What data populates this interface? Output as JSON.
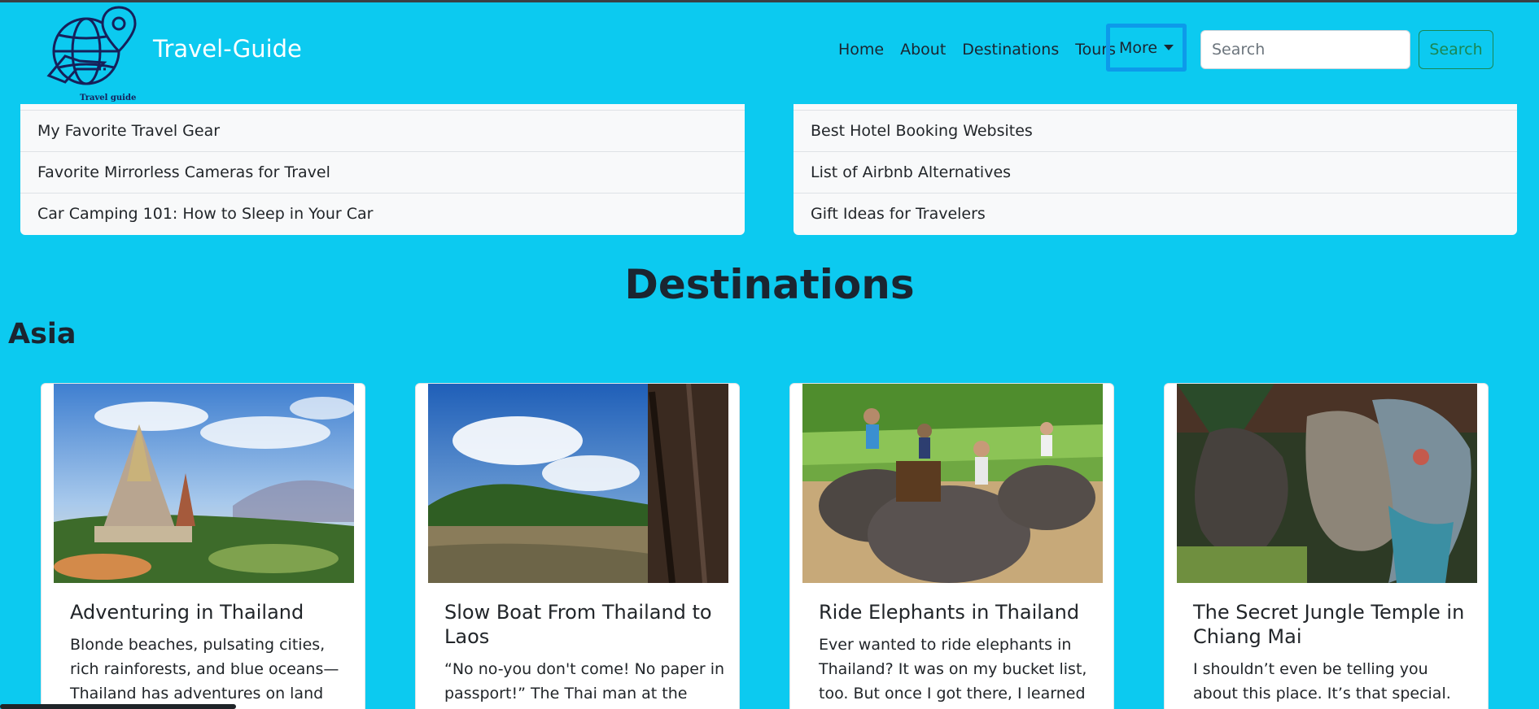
{
  "navbar": {
    "brand": "Travel-Guide",
    "logo_caption": "Travel guide",
    "links": [
      "Home",
      "About",
      "Destinations",
      "Tours"
    ],
    "more_label": "More",
    "search_placeholder": "Search",
    "search_button": "Search"
  },
  "dropdown": {
    "left_items": [
      "My Favorite Travel Gear",
      "Favorite Mirrorless Cameras for Travel",
      "Car Camping 101: How to Sleep in Your Car"
    ],
    "right_items": [
      "Best Hotel Booking Websites",
      "List of Airbnb Alternatives",
      "Gift Ideas for Travelers"
    ]
  },
  "main": {
    "section_title": "Destinations",
    "region_title": "Asia",
    "cards": [
      {
        "title": "Adventuring in Thailand",
        "text": "Blonde beaches, pulsating cities, rich rainforests, and blue oceans—Thailand has adventures on land and"
      },
      {
        "title": "Slow Boat From Thailand to Laos",
        "text": "“No no-you don't come! No paper in passport!” The Thai man at the"
      },
      {
        "title": "Ride Elephants in Thailand",
        "text": "Ever wanted to ride elephants in Thailand? It was on my bucket list, too. But once I got there, I learned—"
      },
      {
        "title": "The Secret Jungle Temple in Chiang Mai",
        "text": "I shouldn’t even be telling you about this place. It’s that special. Wat Palad"
      }
    ]
  },
  "colors": {
    "page_background": "#0ccaf0",
    "search_button": "#198754",
    "more_focus_border": "#0d9aea"
  }
}
